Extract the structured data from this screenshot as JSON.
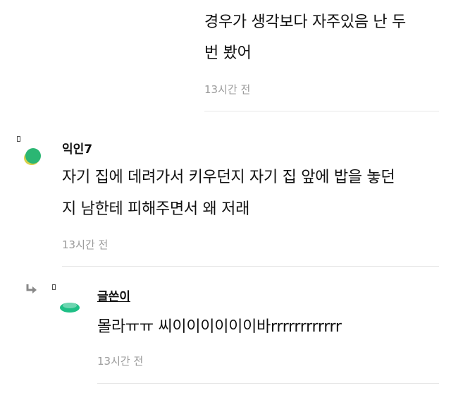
{
  "comments": [
    {
      "lines": [
        "경우가 생각보다 자주있음 난 두",
        "번 봤어"
      ],
      "time": "13시간 전"
    },
    {
      "author": "익인7",
      "lines": [
        "자기 집에 데려가서 키우던지 자기 집 앞에 밥을 놓던",
        "지 남한테 피해주면서 왜 저래"
      ],
      "time": "13시간 전",
      "avatar_color": "#2bb673",
      "avatar_shadow": "#d8d04a"
    },
    {
      "author": "글쓴이",
      "lines": [
        "몰라ㅠㅠ 씨이이이이이이바rrrrrrrrrrrr"
      ],
      "time": "13시간 전",
      "avatar_color": "#1fbf86"
    }
  ],
  "icons": {
    "marker": "small-square-marker-icon",
    "reply": "reply-arrow-icon"
  }
}
